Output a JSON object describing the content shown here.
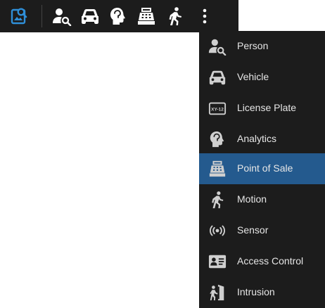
{
  "toolbar": {
    "buttons": [
      {
        "icon": "image-search-icon",
        "color": "#2f8fd8"
      },
      {
        "icon": "person-search-icon",
        "color": "#ffffff"
      },
      {
        "icon": "car-icon",
        "color": "#ffffff"
      },
      {
        "icon": "head-analytics-icon",
        "color": "#ffffff"
      },
      {
        "icon": "cash-register-icon",
        "color": "#ffffff"
      },
      {
        "icon": "running-person-icon",
        "color": "#ffffff"
      },
      {
        "icon": "more-vertical-icon",
        "color": "#ffffff"
      }
    ]
  },
  "menu": {
    "items": [
      {
        "label": "Person",
        "icon": "person-search-icon"
      },
      {
        "label": "Vehicle",
        "icon": "car-icon"
      },
      {
        "label": "License Plate",
        "icon": "license-plate-icon",
        "plate_text": "XY-12"
      },
      {
        "label": "Analytics",
        "icon": "head-analytics-icon"
      },
      {
        "label": "Point of Sale",
        "icon": "cash-register-icon",
        "selected": true
      },
      {
        "label": "Motion",
        "icon": "running-person-icon"
      },
      {
        "label": "Sensor",
        "icon": "sensor-icon"
      },
      {
        "label": "Access Control",
        "icon": "id-card-icon"
      },
      {
        "label": "Intrusion",
        "icon": "intrusion-icon"
      }
    ]
  },
  "colors": {
    "background": "#1c1c1c",
    "selected": "#245a8e",
    "accent": "#2f8fd8",
    "text": "#e6e6e6",
    "icon": "#cfcfcf"
  }
}
